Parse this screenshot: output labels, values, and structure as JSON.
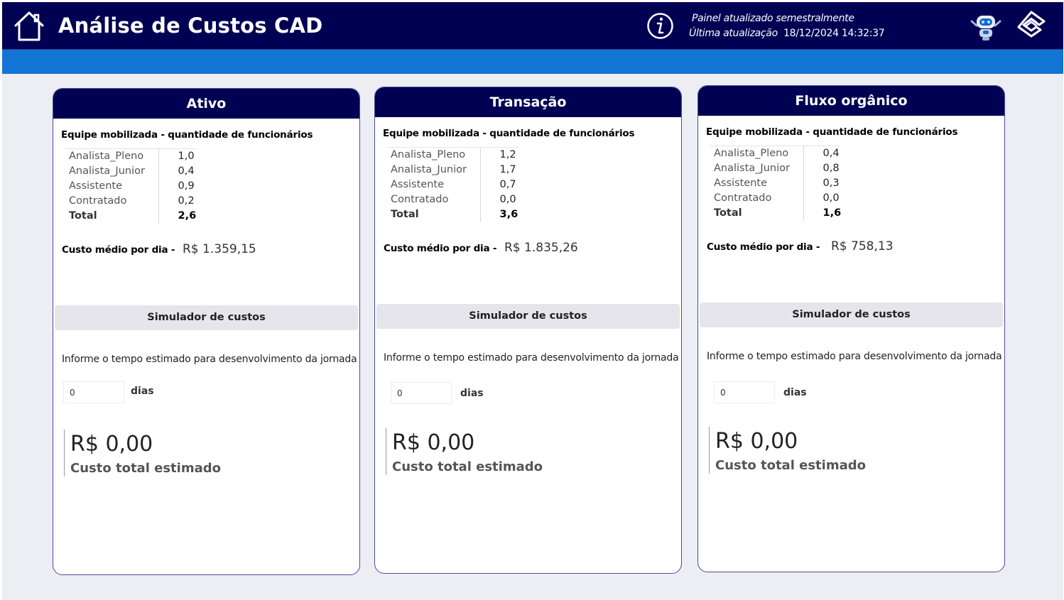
{
  "header": {
    "title": "Análise de Custos CAD",
    "update_note": "Painel atualizado semestralmente",
    "last_update_label": "Última atualização",
    "last_update_value": "18/12/2024 14:32:37",
    "icons": [
      "home-icon",
      "info-icon",
      "robot-icon",
      "bank-logo-icon"
    ]
  },
  "colors": {
    "header_bg": "#010153",
    "band": "#1275d4",
    "page_bg": "#eceef4",
    "card_border": "#4a4a9a"
  },
  "cards": [
    {
      "title": "Ativo",
      "team_title": "Equipe mobilizada - quantidade de funcionários",
      "rows": [
        {
          "name": "Analista_Pleno",
          "value": "1,0"
        },
        {
          "name": "Analista_Junior",
          "value": "0,4"
        },
        {
          "name": "Assistente",
          "value": "0,9"
        },
        {
          "name": "Contratado",
          "value": "0,2"
        }
      ],
      "total_label": "Total",
      "total_value": "2,6",
      "avg_label": "Custo médio por dia -",
      "avg_value": "R$ 1.359,15",
      "simulator_title": "Simulador de custos",
      "prompt": "Informe o tempo estimado para desenvolvimento da jornada",
      "days_value": "0",
      "days_label": "dias",
      "total_cost": "R$ 0,00",
      "total_cost_label": "Custo total estimado"
    },
    {
      "title": "Transação",
      "team_title": "Equipe mobilizada - quantidade de funcionários",
      "rows": [
        {
          "name": "Analista_Pleno",
          "value": "1,2"
        },
        {
          "name": "Analista_Junior",
          "value": "1,7"
        },
        {
          "name": "Assistente",
          "value": "0,7"
        },
        {
          "name": "Contratado",
          "value": "0,0"
        }
      ],
      "total_label": "Total",
      "total_value": "3,6",
      "avg_label": "Custo médio por dia -",
      "avg_value": "R$ 1.835,26",
      "simulator_title": "Simulador de custos",
      "prompt": "Informe o tempo estimado para desenvolvimento da jornada",
      "days_value": "0",
      "days_label": "dias",
      "total_cost": "R$ 0,00",
      "total_cost_label": "Custo total estimado"
    },
    {
      "title": "Fluxo orgânico",
      "team_title": "Equipe mobilizada - quantidade de funcionários",
      "rows": [
        {
          "name": "Analista_Pleno",
          "value": "0,4"
        },
        {
          "name": "Analista_Junior",
          "value": "0,8"
        },
        {
          "name": "Assistente",
          "value": "0,3"
        },
        {
          "name": "Contratado",
          "value": "0,0"
        }
      ],
      "total_label": "Total",
      "total_value": "1,6",
      "avg_label": "Custo médio por dia -",
      "avg_value": "R$ 758,13",
      "simulator_title": "Simulador de custos",
      "prompt": "Informe o tempo estimado para desenvolvimento da jornada",
      "days_value": "0",
      "days_label": "dias",
      "total_cost": "R$ 0,00",
      "total_cost_label": "Custo total estimado"
    }
  ]
}
